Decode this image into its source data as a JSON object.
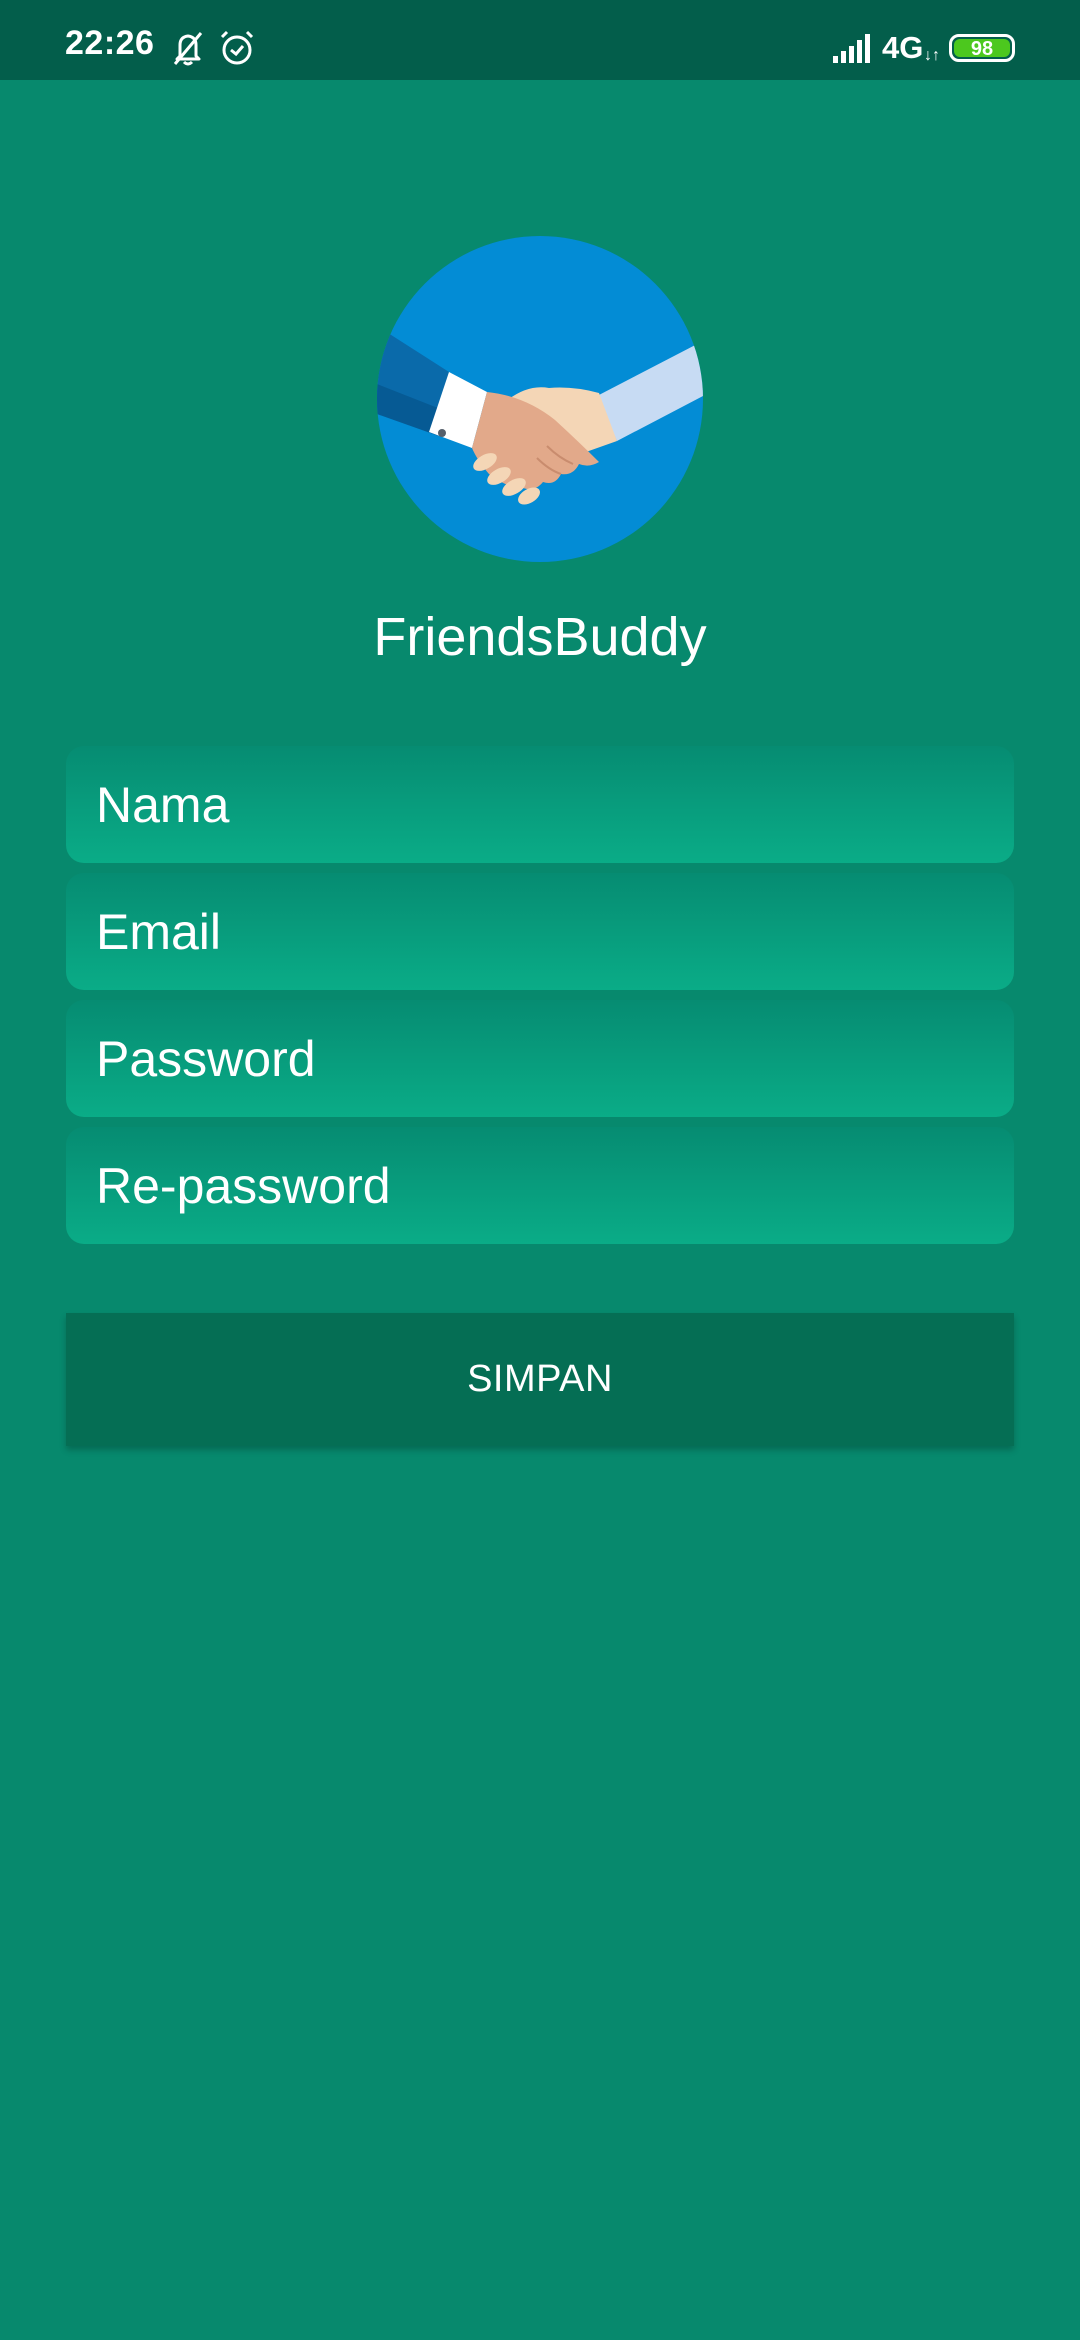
{
  "status_bar": {
    "time": "22:26",
    "network": "4G",
    "network_arrows": "↓↑",
    "battery_level": "98",
    "icons": [
      "bell-off-icon",
      "alarm-icon",
      "signal-icon",
      "battery-icon"
    ]
  },
  "app": {
    "name": "FriendsBuddy",
    "logo": "handshake-icon"
  },
  "form": {
    "name_placeholder": "Nama",
    "email_placeholder": "Email",
    "password_placeholder": "Password",
    "repassword_placeholder": "Re-password",
    "submit_label": "SIMPAN"
  },
  "colors": {
    "background": "#07896d",
    "status_bar": "#035e4b",
    "field_top": "#068c72",
    "field_bottom": "#0aac87",
    "button": "#056e54",
    "logo_circle": "#038cd5"
  }
}
